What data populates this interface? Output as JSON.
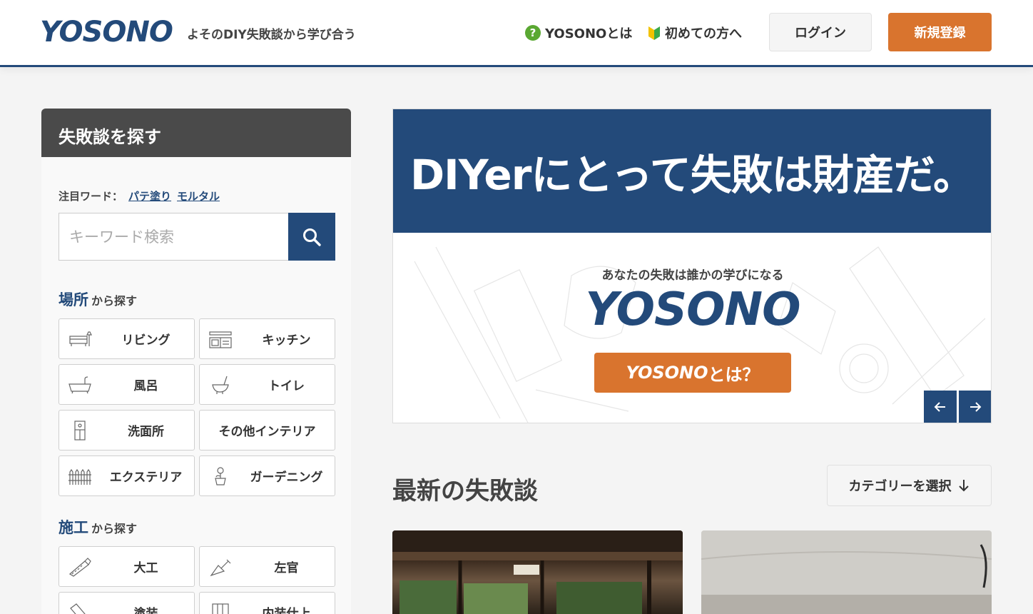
{
  "header": {
    "logo": "YOSONO",
    "tagline": "よそのDIY失敗談から学び合う",
    "nav_about": "YOSONOとは",
    "nav_beginner": "初めての方へ",
    "login": "ログイン",
    "signup": "新規登録"
  },
  "sidebar": {
    "title": "失敗談を探す",
    "hot_words_label": "注目ワード：",
    "hot_words": [
      "パテ塗り",
      "モルタル"
    ],
    "search_placeholder": "キーワード検索",
    "place_section": {
      "em": "場所",
      "rest": "から探す"
    },
    "places": [
      "リビング",
      "キッチン",
      "風呂",
      "トイレ",
      "洗面所",
      "その他インテリア",
      "エクステリア",
      "ガーデニング"
    ],
    "work_section": {
      "em": "施工",
      "rest": "から探す"
    },
    "works": [
      "大工",
      "左官",
      "塗装",
      "内装仕上"
    ]
  },
  "hero": {
    "title": "DIYerにとって失敗は財産だ。",
    "subtitle": "あなたの失敗は誰かの学びになる",
    "logo": "YOSONO",
    "button_brand": "YOSONO",
    "button_rest": "とは？"
  },
  "main": {
    "latest_title": "最新の失敗談",
    "category_select": "カテゴリーを選択"
  },
  "colors": {
    "brand": "#234a7a",
    "accent": "#d9742e"
  }
}
